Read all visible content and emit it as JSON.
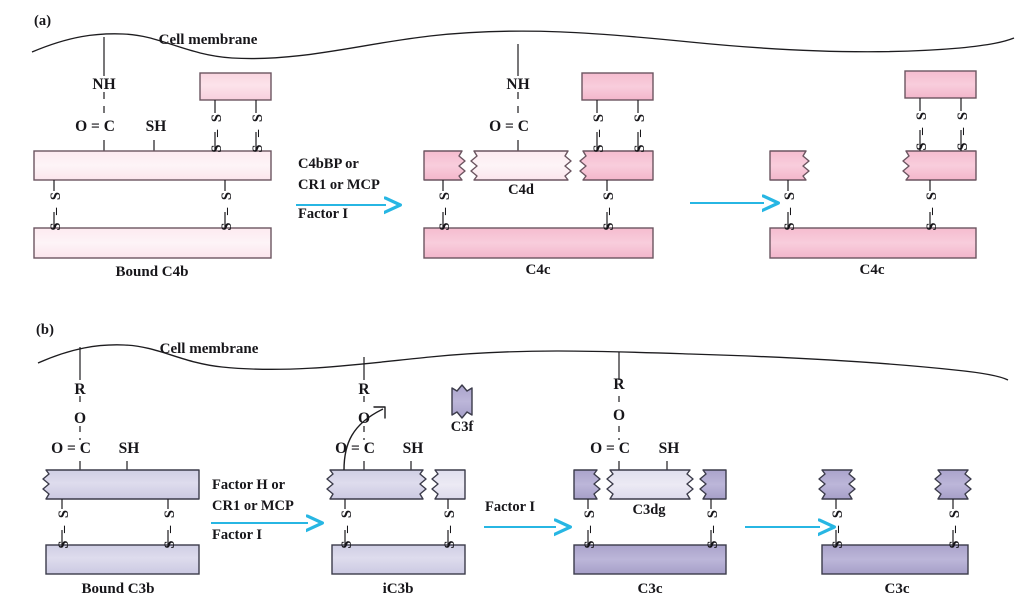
{
  "figure": {
    "type": "diagram",
    "subject": "Complement regulation: proteolytic cleavage of bound C4b and C3b",
    "panels": [
      "a",
      "b"
    ]
  },
  "panel_a": {
    "label": "(a)",
    "membrane_label": "Cell membrane",
    "accent_arrow_color": "#27b6e3",
    "colors": {
      "light": "#fbdfe7",
      "lighter": "#fdeef2",
      "mid": "#f6c3d4",
      "stroke": "#6b5560"
    },
    "stages": [
      {
        "id": "bound-c4b",
        "caption": "Bound C4b",
        "atoms": [
          "NH",
          "O = C",
          "SH"
        ]
      },
      {
        "id": "c4c-1",
        "caption": "C4c",
        "fragment_label": "C4d",
        "atoms": [
          "NH",
          "O = C"
        ]
      },
      {
        "id": "c4c-2",
        "caption": "C4c",
        "atoms": []
      }
    ],
    "arrows": [
      {
        "id": "arrow-a1",
        "above": [
          "C4bBP or",
          "CR1 or MCP"
        ],
        "below": [
          "Factor I"
        ]
      },
      {
        "id": "arrow-a2",
        "above": [],
        "below": []
      }
    ]
  },
  "panel_b": {
    "label": "(b)",
    "membrane_label": "Cell membrane",
    "accent_arrow_color": "#27b6e3",
    "colors": {
      "light": "#d5d4e8",
      "lighter": "#e3e2f0",
      "mid": "#b3aed2",
      "stroke": "#3b3b4a"
    },
    "stages": [
      {
        "id": "bound-c3b",
        "caption": "Bound C3b",
        "atoms": [
          "R",
          "O",
          "O = C",
          "SH"
        ]
      },
      {
        "id": "ic3b",
        "caption": "iC3b",
        "released_fragment": "C3f",
        "atoms": [
          "R",
          "O",
          "O = C",
          "SH"
        ]
      },
      {
        "id": "c3c-1",
        "caption": "C3c",
        "fragment_label": "C3dg",
        "atoms": [
          "R",
          "O",
          "O = C",
          "SH"
        ]
      },
      {
        "id": "c3c-2",
        "caption": "C3c",
        "atoms": []
      }
    ],
    "arrows": [
      {
        "id": "arrow-b1",
        "above": [
          "Factor H or",
          "CR1 or MCP"
        ],
        "below": [
          "Factor I"
        ]
      },
      {
        "id": "arrow-b2",
        "above": [
          "Factor I"
        ],
        "below": []
      },
      {
        "id": "arrow-b3",
        "above": [],
        "below": []
      }
    ]
  },
  "disulfide": {
    "glyph": "S – S",
    "label": "disulfide-bond"
  }
}
